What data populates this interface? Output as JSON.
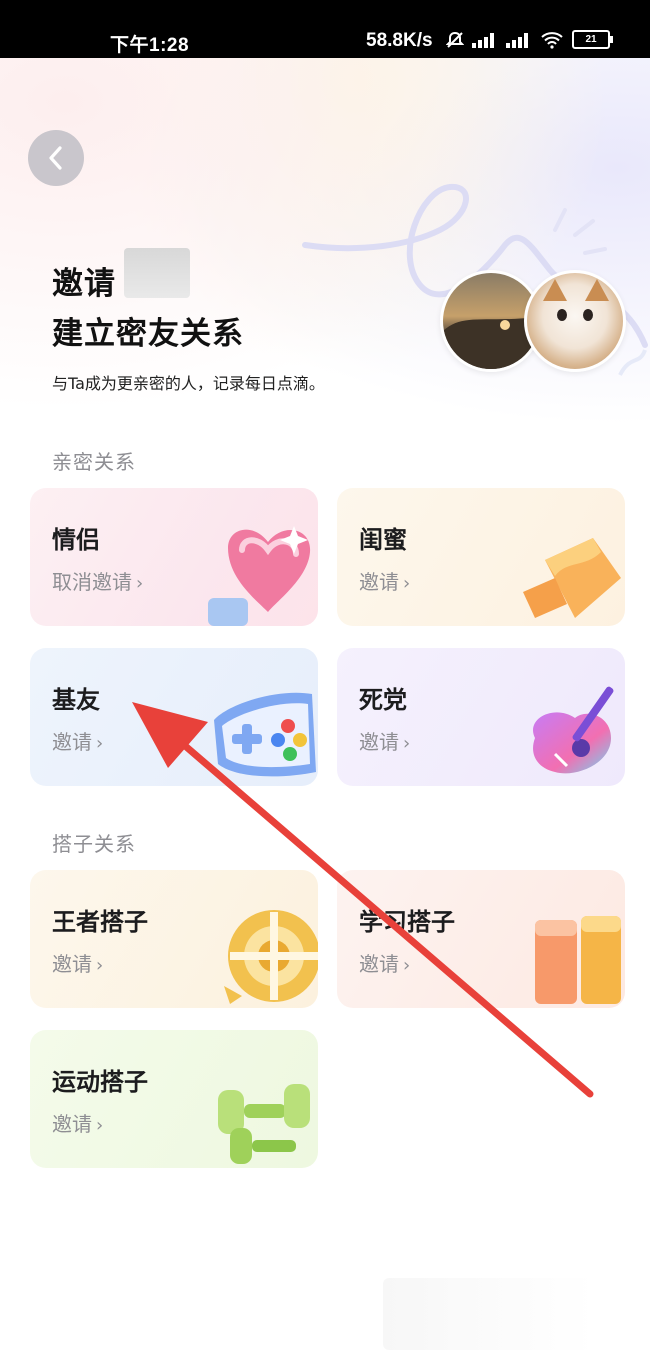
{
  "status_bar": {
    "time": "下午1:28",
    "speed": "58.8K/s",
    "battery": "21"
  },
  "header": {
    "title_line1": "邀请",
    "title_line2": "建立密友关系",
    "subtitle": "与Ta成为更亲密的人，记录每日点滴。"
  },
  "sections": {
    "intimate_label": "亲密关系",
    "partner_label": "搭子关系"
  },
  "cards": {
    "lover": {
      "name": "情侣",
      "action": "取消邀请"
    },
    "bestie": {
      "name": "闺蜜",
      "action": "邀请"
    },
    "buddy": {
      "name": "基友",
      "action": "邀请"
    },
    "diehard": {
      "name": "死党",
      "action": "邀请"
    },
    "king": {
      "name": "王者搭子",
      "action": "邀请"
    },
    "study": {
      "name": "学习搭子",
      "action": "邀请"
    },
    "sport": {
      "name": "运动搭子",
      "action": "邀请"
    }
  },
  "icons": {
    "back": "chevron-left-icon",
    "wifi": "wifi-icon",
    "mute": "bell-off-icon",
    "signal": "signal-icon",
    "battery": "battery-icon"
  },
  "colors": {
    "annotation_arrow": "#e8413a",
    "secondary_text": "#8e8e93",
    "primary_text": "#1c1c1e"
  }
}
